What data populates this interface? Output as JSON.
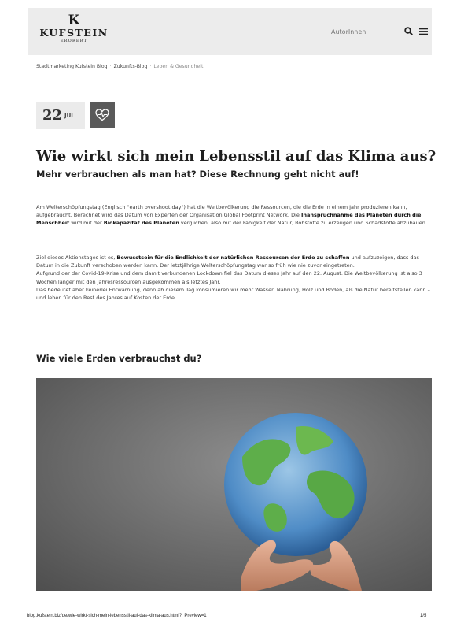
{
  "header": {
    "logo_mark": "K",
    "logo_name": "KUFSTEIN",
    "logo_sub": "ERORERT",
    "nav_link": "AutorInnen",
    "icons": [
      "search-icon",
      "menu-icon"
    ]
  },
  "breadcrumb": {
    "items": [
      "Stadtmarketing Kufstein Blog",
      "Zukunfts-Blog",
      "Leben & Gesundheit"
    ],
    "separator": "·"
  },
  "post": {
    "date_day": "22",
    "date_month": "JUL",
    "category_icon": "heart-health-icon",
    "title": "Wie wirkt sich mein Lebensstil auf das Klima aus?",
    "subtitle": "Mehr verbrauchen als man hat? Diese Rechnung geht nicht auf!",
    "p1": {
      "a": "Am Welterschöpfungstag (Englisch \"earth overshoot day\") hat die Weltbevölkerung die Ressourcen, die die Erde in einem Jahr produzieren kann, aufgebraucht. Berechnet wird das Datum von Experten der Organisation Global Footprint Network. Die ",
      "b": "Inanspruchnahme des Planeten durch die Menschheit",
      "c": " wird mit der ",
      "d": "Biokapazität des Planeten",
      "e": " verglichen, also mit der Fähigkeit der Natur, Rohstoffe zu erzeugen und Schadstoffe abzubauen."
    },
    "p2": {
      "a": "Ziel dieses Aktionstages ist es, ",
      "b": "Bewusstsein für die Endlichkeit der natürlichen Ressourcen der Erde zu schaffen",
      "c": " und aufzuzeigen, dass das Datum in die Zukunft verschoben werden kann. Der letztjährige Welterschöpfungstag war so früh wie nie zuvor eingetreten.",
      "d": "Aufgrund der der Covid-19-Krise und dem damit verbundenen Lockdown fiel das Datum dieses Jahr auf den 22. August. Die Weltbevölkerung ist also 3 Wochen länger mit den Jahresressourcen ausgekommen als letztes Jahr.",
      "e": "Das bedeutet aber keinerlei Entwarnung, denn ab diesem Tag konsumieren wir mehr Wasser, Nahrung, Holz und Boden, als die Natur bereitstellen kann – und leben für den Rest des Jahres auf Kosten der Erde."
    },
    "heading2": "Wie viele Erden verbrauchst du?"
  },
  "footer": {
    "url": "blog.kufstein.biz/de/wie-wirkt-sich-mein-lebensstil-auf-das-klima-aus.html?_Preview=1",
    "page": "1/5"
  }
}
